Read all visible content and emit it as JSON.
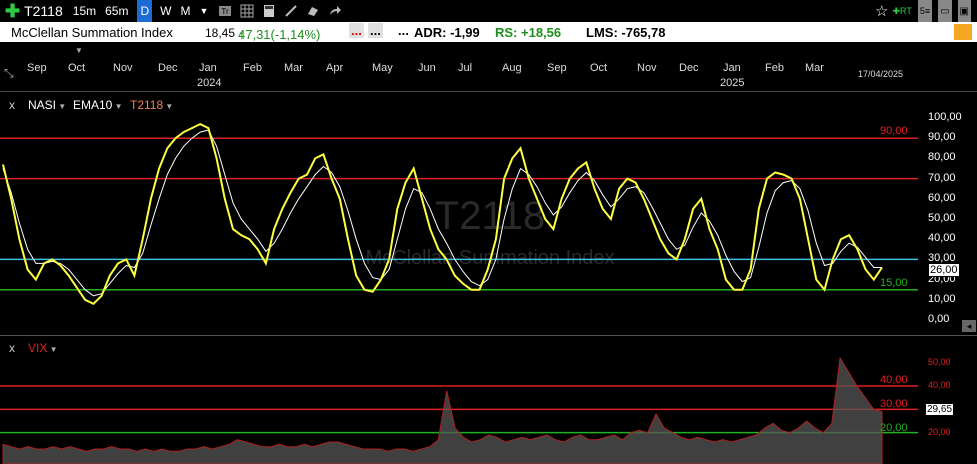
{
  "toolbar": {
    "symbol": "T2118",
    "timeframes": [
      "15m",
      "65m",
      "D",
      "W",
      "M"
    ],
    "active_timeframe": "D",
    "rt_label": "RT"
  },
  "infobar": {
    "title": "McClellan Summation Index",
    "last": "18,45",
    "change": "47,31(-1,14%)",
    "dots1": "...",
    "dots2": "...",
    "dots3": "...",
    "adr": "ADR: -1,99",
    "rs": "RS:  +18,56",
    "lms": "LMS: -765,78"
  },
  "time_axis": {
    "months": [
      "Sep",
      "Oct",
      "Nov",
      "Dec",
      "Jan",
      "Feb",
      "Mar",
      "Apr",
      "May",
      "Jun",
      "Jul",
      "Aug",
      "Sep",
      "Oct",
      "Nov",
      "Dec",
      "Jan",
      "Feb",
      "Mar"
    ],
    "years": [
      "2024",
      "2025"
    ],
    "last_date": "17/04/2025"
  },
  "pane1": {
    "close": "x",
    "series": [
      "NASI",
      "EMA10",
      "T2118"
    ],
    "watermark_symbol": "T2118",
    "watermark_name": "McClellan Summation Index",
    "axis_ticks": [
      "100,00",
      "90,00",
      "80,00",
      "70,00",
      "60,00",
      "50,00",
      "40,00",
      "30,00",
      "20,00",
      "10,00",
      "0,00"
    ],
    "line_labels": {
      "red_top": "90,00",
      "green": "15,00"
    },
    "current": "26,00"
  },
  "pane2": {
    "close": "x",
    "series": [
      "VIX"
    ],
    "axis_ticks": [
      "50,00",
      "40,00",
      "20,00"
    ],
    "line_labels": {
      "red_top": "40,00",
      "red_mid": "30,00",
      "green": "20,00"
    },
    "current": "29,65"
  },
  "colors": {
    "nasi": "#ffff40",
    "ema": "#ffffff",
    "red": "#e02020",
    "cyan": "#40c0e0",
    "green": "#20b020"
  },
  "chart_data": [
    {
      "type": "line",
      "title": "T2118",
      "series": [
        {
          "name": "NASI",
          "values": [
            77,
            60,
            40,
            25,
            20,
            28,
            30,
            27,
            22,
            16,
            10,
            8,
            12,
            22,
            28,
            30,
            22,
            40,
            60,
            75,
            85,
            90,
            93,
            95,
            97,
            95,
            80,
            60,
            45,
            42,
            40,
            35,
            28,
            45,
            55,
            63,
            70,
            72,
            80,
            82,
            70,
            60,
            40,
            22,
            15,
            14,
            20,
            30,
            55,
            68,
            75,
            60,
            45,
            35,
            30,
            22,
            18,
            15,
            15,
            25,
            40,
            70,
            80,
            85,
            70,
            60,
            50,
            45,
            60,
            70,
            75,
            78,
            65,
            55,
            50,
            65,
            70,
            68,
            60,
            50,
            40,
            33,
            30,
            40,
            55,
            60,
            45,
            35,
            20,
            15,
            15,
            25,
            55,
            70,
            73,
            72,
            70,
            60,
            40,
            20,
            15,
            30,
            40,
            42,
            35,
            25,
            20,
            26
          ]
        },
        {
          "name": "EMA10",
          "values": [
            75,
            63,
            48,
            35,
            28,
            28,
            29,
            28,
            25,
            20,
            15,
            12,
            13,
            18,
            23,
            27,
            26,
            33,
            47,
            60,
            72,
            80,
            86,
            90,
            93,
            94,
            86,
            72,
            58,
            50,
            45,
            40,
            34,
            38,
            45,
            53,
            60,
            66,
            72,
            76,
            73,
            66,
            54,
            40,
            28,
            21,
            20,
            25,
            40,
            55,
            65,
            63,
            55,
            45,
            38,
            30,
            24,
            19,
            17,
            20,
            30,
            50,
            65,
            75,
            72,
            66,
            58,
            52,
            56,
            63,
            69,
            73,
            69,
            62,
            56,
            60,
            65,
            66,
            63,
            56,
            48,
            40,
            35,
            37,
            46,
            53,
            49,
            42,
            32,
            24,
            19,
            21,
            36,
            53,
            64,
            68,
            69,
            65,
            54,
            38,
            27,
            28,
            34,
            38,
            36,
            31,
            26,
            26
          ]
        }
      ],
      "ylim": [
        0,
        100
      ],
      "hlines": [
        90,
        70,
        30,
        15
      ]
    },
    {
      "type": "area",
      "title": "VIX",
      "series": [
        {
          "name": "VIX",
          "values": [
            15,
            14,
            13,
            14,
            13,
            13,
            14,
            13,
            14,
            13,
            12,
            13,
            13,
            14,
            13,
            13,
            12,
            13,
            12,
            13,
            12,
            12,
            13,
            13,
            14,
            13,
            14,
            15,
            17,
            16,
            15,
            14,
            14,
            15,
            14,
            14,
            15,
            14,
            15,
            16,
            16,
            15,
            14,
            13,
            13,
            13,
            12,
            13,
            13,
            12,
            13,
            14,
            17,
            38,
            22,
            18,
            16,
            17,
            19,
            18,
            16,
            17,
            18,
            17,
            18,
            19,
            17,
            16,
            18,
            19,
            17,
            17,
            18,
            19,
            17,
            20,
            21,
            20,
            28,
            22,
            20,
            18,
            17,
            18,
            17,
            16,
            17,
            16,
            17,
            18,
            19,
            22,
            24,
            21,
            20,
            22,
            25,
            22,
            20,
            24,
            52,
            46,
            40,
            35,
            30,
            29
          ]
        }
      ],
      "ylim": [
        10,
        55
      ],
      "hlines": [
        40,
        30,
        20
      ]
    }
  ]
}
